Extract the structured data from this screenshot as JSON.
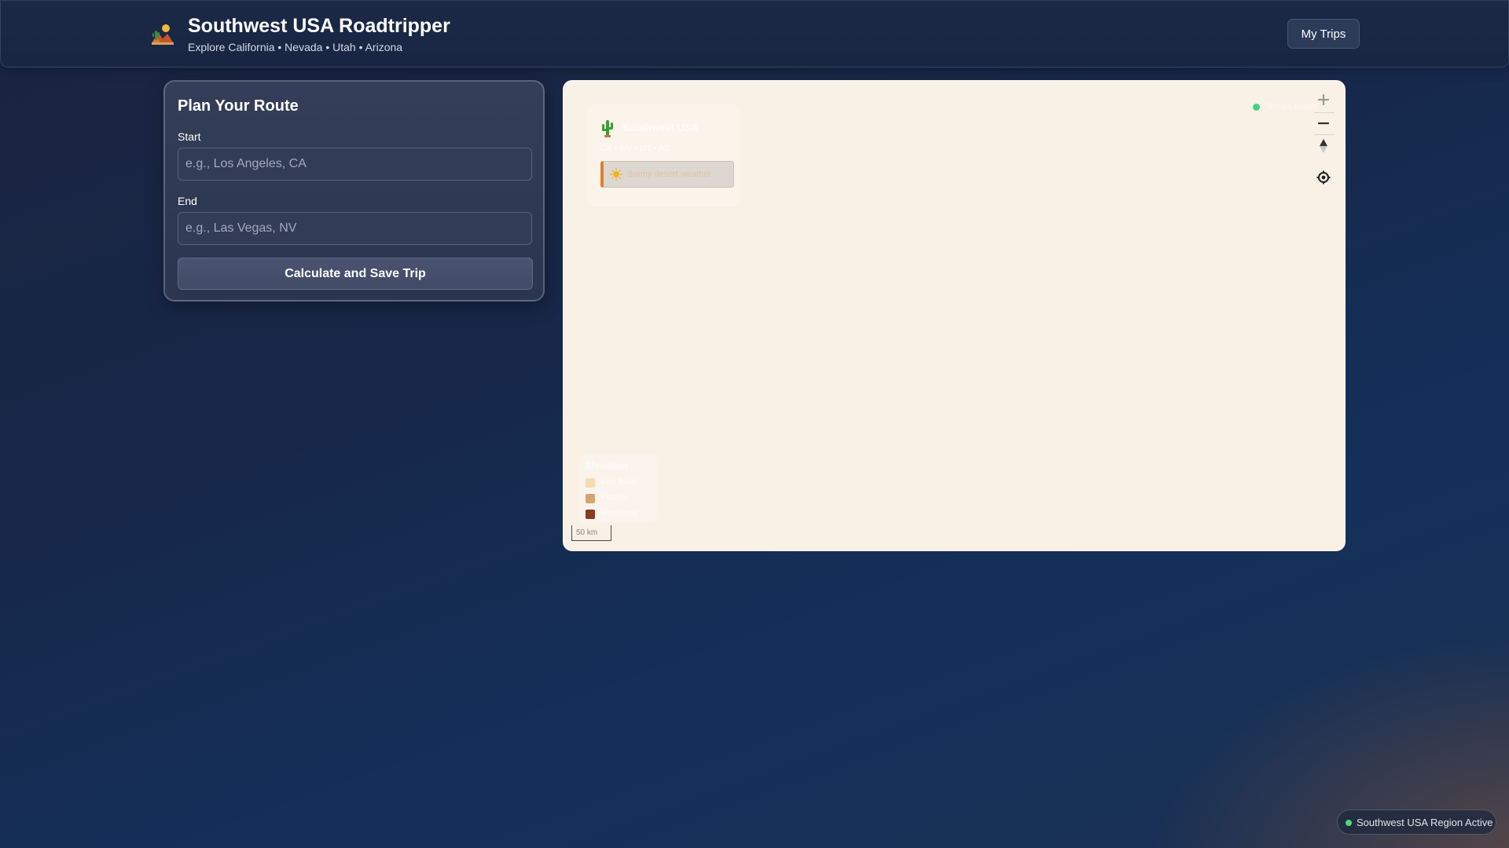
{
  "header": {
    "title": "Southwest USA Roadtripper",
    "subtitle": "Explore California • Nevada • Utah • Arizona",
    "logo_icon": "desert-landscape-icon",
    "my_trips_label": "My Trips"
  },
  "route_panel": {
    "title": "Plan Your Route",
    "start_label": "Start",
    "start_value": "",
    "start_placeholder": "e.g., Los Angeles, CA",
    "end_label": "End",
    "end_value": "",
    "end_placeholder": "e.g., Las Vegas, NV",
    "submit_label": "Calculate and Save Trip"
  },
  "map": {
    "background": "#faf1e6",
    "region_card": {
      "name": "Southwest USA",
      "states": "CA • NV • UT • AZ",
      "weather": "Sunny desert weather",
      "icon": "cactus-icon",
      "weather_icon": "sun-icon",
      "accent": "#e87b25"
    },
    "live_badge": "Terrain Active",
    "controls": {
      "zoom_in": "zoom-in-icon",
      "zoom_out": "zoom-out-icon",
      "compass": "compass-icon",
      "locate": "locate-icon"
    },
    "legend": {
      "title": "Elevation",
      "items": [
        {
          "label": "Low Basin",
          "color": "#f5dcb4"
        },
        {
          "label": "Plateau",
          "color": "#d4a574"
        },
        {
          "label": "Mountains",
          "color": "#8b3a1e"
        }
      ]
    },
    "scale": "50 km"
  },
  "status": {
    "text": "Southwest USA Region Active",
    "color": "#4cd97f"
  }
}
